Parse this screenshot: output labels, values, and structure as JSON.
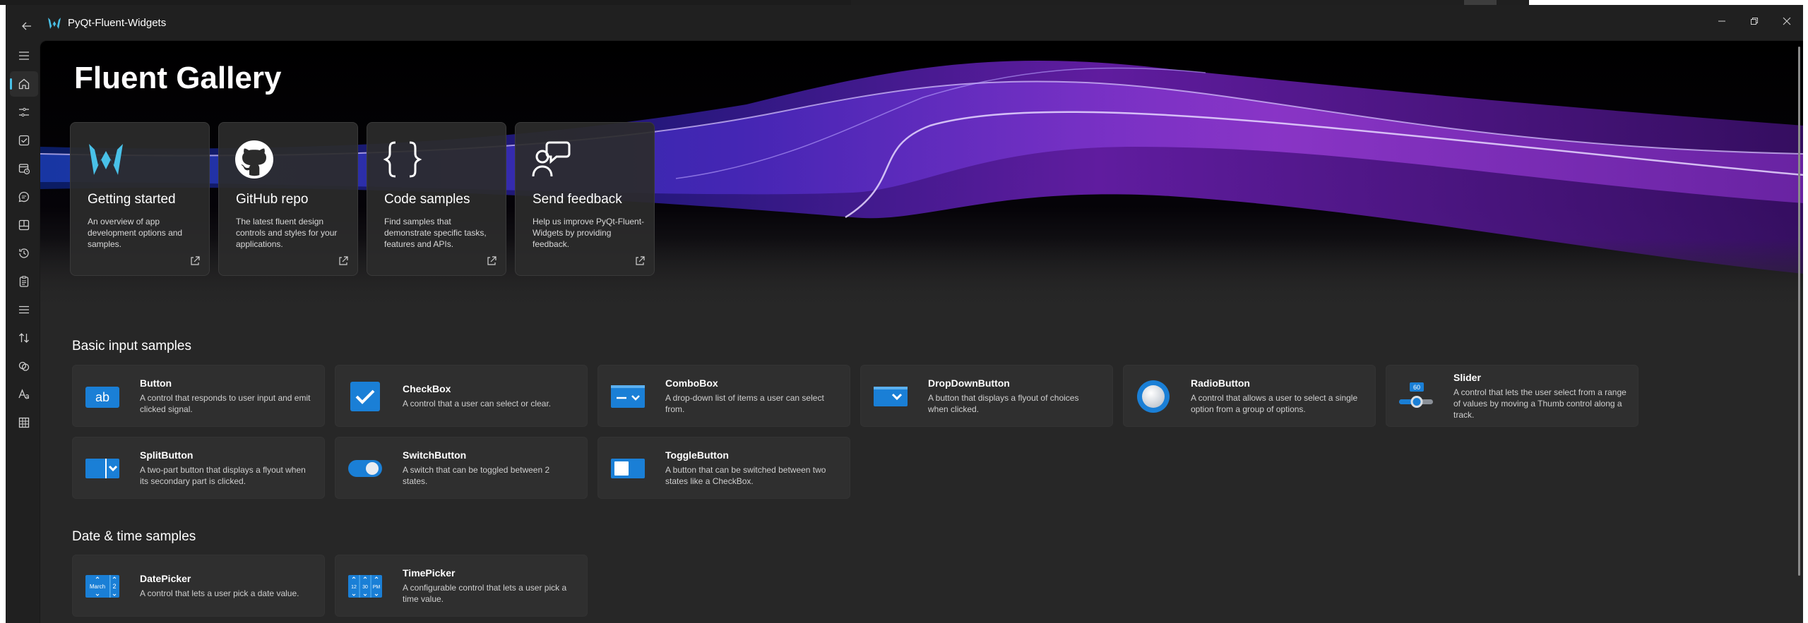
{
  "window": {
    "title": "PyQt-Fluent-Widgets"
  },
  "colors": {
    "accent": "#49c1e8",
    "icon_blue": "#1a7fd6",
    "window_bg": "#202020",
    "content_bg": "#272727"
  },
  "sidebar": {
    "items": [
      {
        "icon": "menu-icon"
      },
      {
        "icon": "home-icon",
        "active": true
      },
      {
        "icon": "input-controls-icon"
      },
      {
        "icon": "checkbox-icon"
      },
      {
        "icon": "date-time-icon"
      },
      {
        "icon": "chat-dialog-icon"
      },
      {
        "icon": "layout-icon"
      },
      {
        "icon": "history-icon"
      },
      {
        "icon": "clipboard-icon"
      },
      {
        "icon": "list-icon"
      },
      {
        "icon": "sort-arrows-icon"
      },
      {
        "icon": "speech-icon"
      },
      {
        "icon": "text-icon"
      },
      {
        "icon": "grid-icon"
      }
    ]
  },
  "page": {
    "title": "Fluent Gallery"
  },
  "link_cards": [
    {
      "icon": "fluent-logo-icon",
      "title": "Getting started",
      "desc": "An overview of app development options and samples."
    },
    {
      "icon": "github-icon",
      "title": "GitHub repo",
      "desc": "The latest fluent design controls and styles for your applications."
    },
    {
      "icon": "code-braces-icon",
      "title": "Code samples",
      "desc": "Find samples that demonstrate specific tasks, features and APIs."
    },
    {
      "icon": "feedback-icon",
      "title": "Send feedback",
      "desc": "Help us improve PyQt-Fluent-Widgets by providing feedback."
    }
  ],
  "sections": [
    {
      "title": "Basic input samples",
      "cards": [
        {
          "icon": "button-icon",
          "icon_text": "ab",
          "title": "Button",
          "desc": "A control that responds to user input and emit clicked signal."
        },
        {
          "icon": "checkbox-sample-icon",
          "title": "CheckBox",
          "desc": "A control that a user can select or clear."
        },
        {
          "icon": "combobox-icon",
          "title": "ComboBox",
          "desc": "A drop-down list of items a user can select from."
        },
        {
          "icon": "dropdown-button-icon",
          "title": "DropDownButton",
          "desc": "A button that displays a flyout of choices when clicked."
        },
        {
          "icon": "radio-button-icon",
          "title": "RadioButton",
          "desc": "A control that allows a user to select a single option from a group of options."
        },
        {
          "icon": "slider-icon",
          "icon_text": "60",
          "title": "Slider",
          "desc": "A control that lets the user select from a range of values by moving a Thumb control along a track."
        },
        {
          "icon": "split-button-icon",
          "title": "SplitButton",
          "desc": "A two-part button that displays a flyout when its secondary part is clicked."
        },
        {
          "icon": "switch-button-icon",
          "title": "SwitchButton",
          "desc": "A switch that can be toggled between 2 states."
        },
        {
          "icon": "toggle-button-icon",
          "title": "ToggleButton",
          "desc": "A button that can be switched between two states like a CheckBox."
        }
      ]
    },
    {
      "title": "Date & time samples",
      "cards": [
        {
          "icon": "date-picker-icon",
          "icon_text": "March",
          "icon_text2": "2",
          "title": "DatePicker",
          "desc": "A control that lets a user pick a date value."
        },
        {
          "icon": "time-picker-icon",
          "icon_text": "12",
          "icon_text2": "30",
          "icon_text3": "PM",
          "title": "TimePicker",
          "desc": "A configurable control that lets a user pick a time value."
        }
      ]
    }
  ]
}
